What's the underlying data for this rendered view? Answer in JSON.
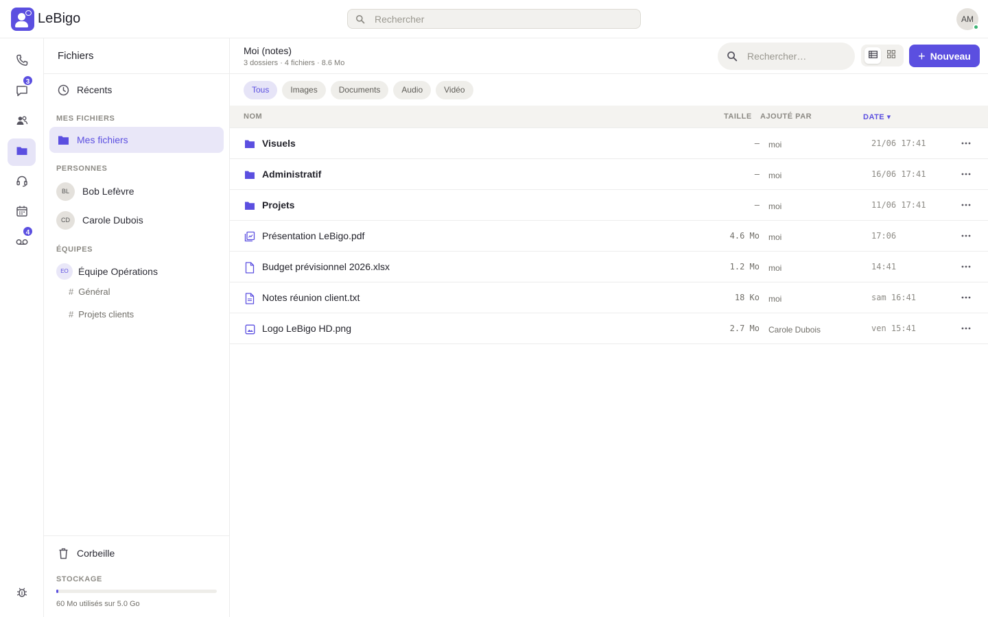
{
  "app": {
    "name": "LeBigo"
  },
  "topbar": {
    "search_placeholder": "Rechercher",
    "avatar_initials": "AM"
  },
  "rail": {
    "items": [
      {
        "icon": "phone-icon"
      },
      {
        "icon": "chat-icon",
        "badge": "3"
      },
      {
        "icon": "contacts-icon"
      },
      {
        "icon": "folder-icon",
        "active": true
      },
      {
        "icon": "headset-icon"
      },
      {
        "icon": "calendar-icon"
      },
      {
        "icon": "voicemail-icon",
        "badge": "4"
      }
    ],
    "bottom_icon": "bug-icon"
  },
  "sidebar": {
    "title": "Fichiers",
    "recents": "Récents",
    "section_my_files": "MES FICHIERS",
    "my_files": "Mes fichiers",
    "section_people": "PERSONNES",
    "people": [
      {
        "initials": "BL",
        "name": "Bob Lefèvre"
      },
      {
        "initials": "CD",
        "name": "Carole Dubois"
      }
    ],
    "section_teams": "ÉQUIPES",
    "team": {
      "initials": "EO",
      "name": "Équipe Opérations"
    },
    "channels": [
      {
        "hash": "#",
        "name": "Général"
      },
      {
        "hash": "#",
        "name": "Projets clients"
      }
    ],
    "trash": "Corbeille",
    "storage_label": "STOCKAGE",
    "storage_text": "60 Mo utilisés sur 5.0 Go",
    "storage_used_fraction": 0.012
  },
  "main": {
    "title": "Moi (notes)",
    "subtitle": "3 dossiers · 4 fichiers · 8.6 Mo",
    "search_placeholder": "Rechercher…",
    "new_button": "Nouveau",
    "new_plus": "+",
    "filters": [
      "Tous",
      "Images",
      "Documents",
      "Audio",
      "Vidéo"
    ],
    "active_filter": "Tous",
    "columns": {
      "name": "NOM",
      "size": "TAILLE",
      "added_by": "AJOUTÉ PAR",
      "date": "DATE ▾"
    },
    "rows": [
      {
        "type": "folder",
        "name": "Visuels",
        "size": "—",
        "added_by": "moi",
        "date": "21/06 17:41",
        "more": "•••"
      },
      {
        "type": "folder",
        "name": "Administratif",
        "size": "—",
        "added_by": "moi",
        "date": "16/06 17:41",
        "more": "•••"
      },
      {
        "type": "folder",
        "name": "Projets",
        "size": "—",
        "added_by": "moi",
        "date": "11/06 17:41",
        "more": "•••"
      },
      {
        "type": "pdf",
        "name": "Présentation LeBigo.pdf",
        "size": "4.6 Mo",
        "added_by": "moi",
        "date": "17:06",
        "more": "•••"
      },
      {
        "type": "sheet",
        "name": "Budget prévisionnel 2026.xlsx",
        "size": "1.2 Mo",
        "added_by": "moi",
        "date": "14:41",
        "more": "•••"
      },
      {
        "type": "text",
        "name": "Notes réunion client.txt",
        "size": "18 Ko",
        "added_by": "moi",
        "date": "sam 16:41",
        "more": "•••"
      },
      {
        "type": "image",
        "name": "Logo LeBigo HD.png",
        "size": "2.7 Mo",
        "added_by": "Carole Dubois",
        "date": "ven 15:41",
        "more": "•••"
      }
    ]
  },
  "colors": {
    "accent": "#5b4fe0",
    "accent_soft": "#e6e4f7",
    "online": "#3bb273"
  }
}
